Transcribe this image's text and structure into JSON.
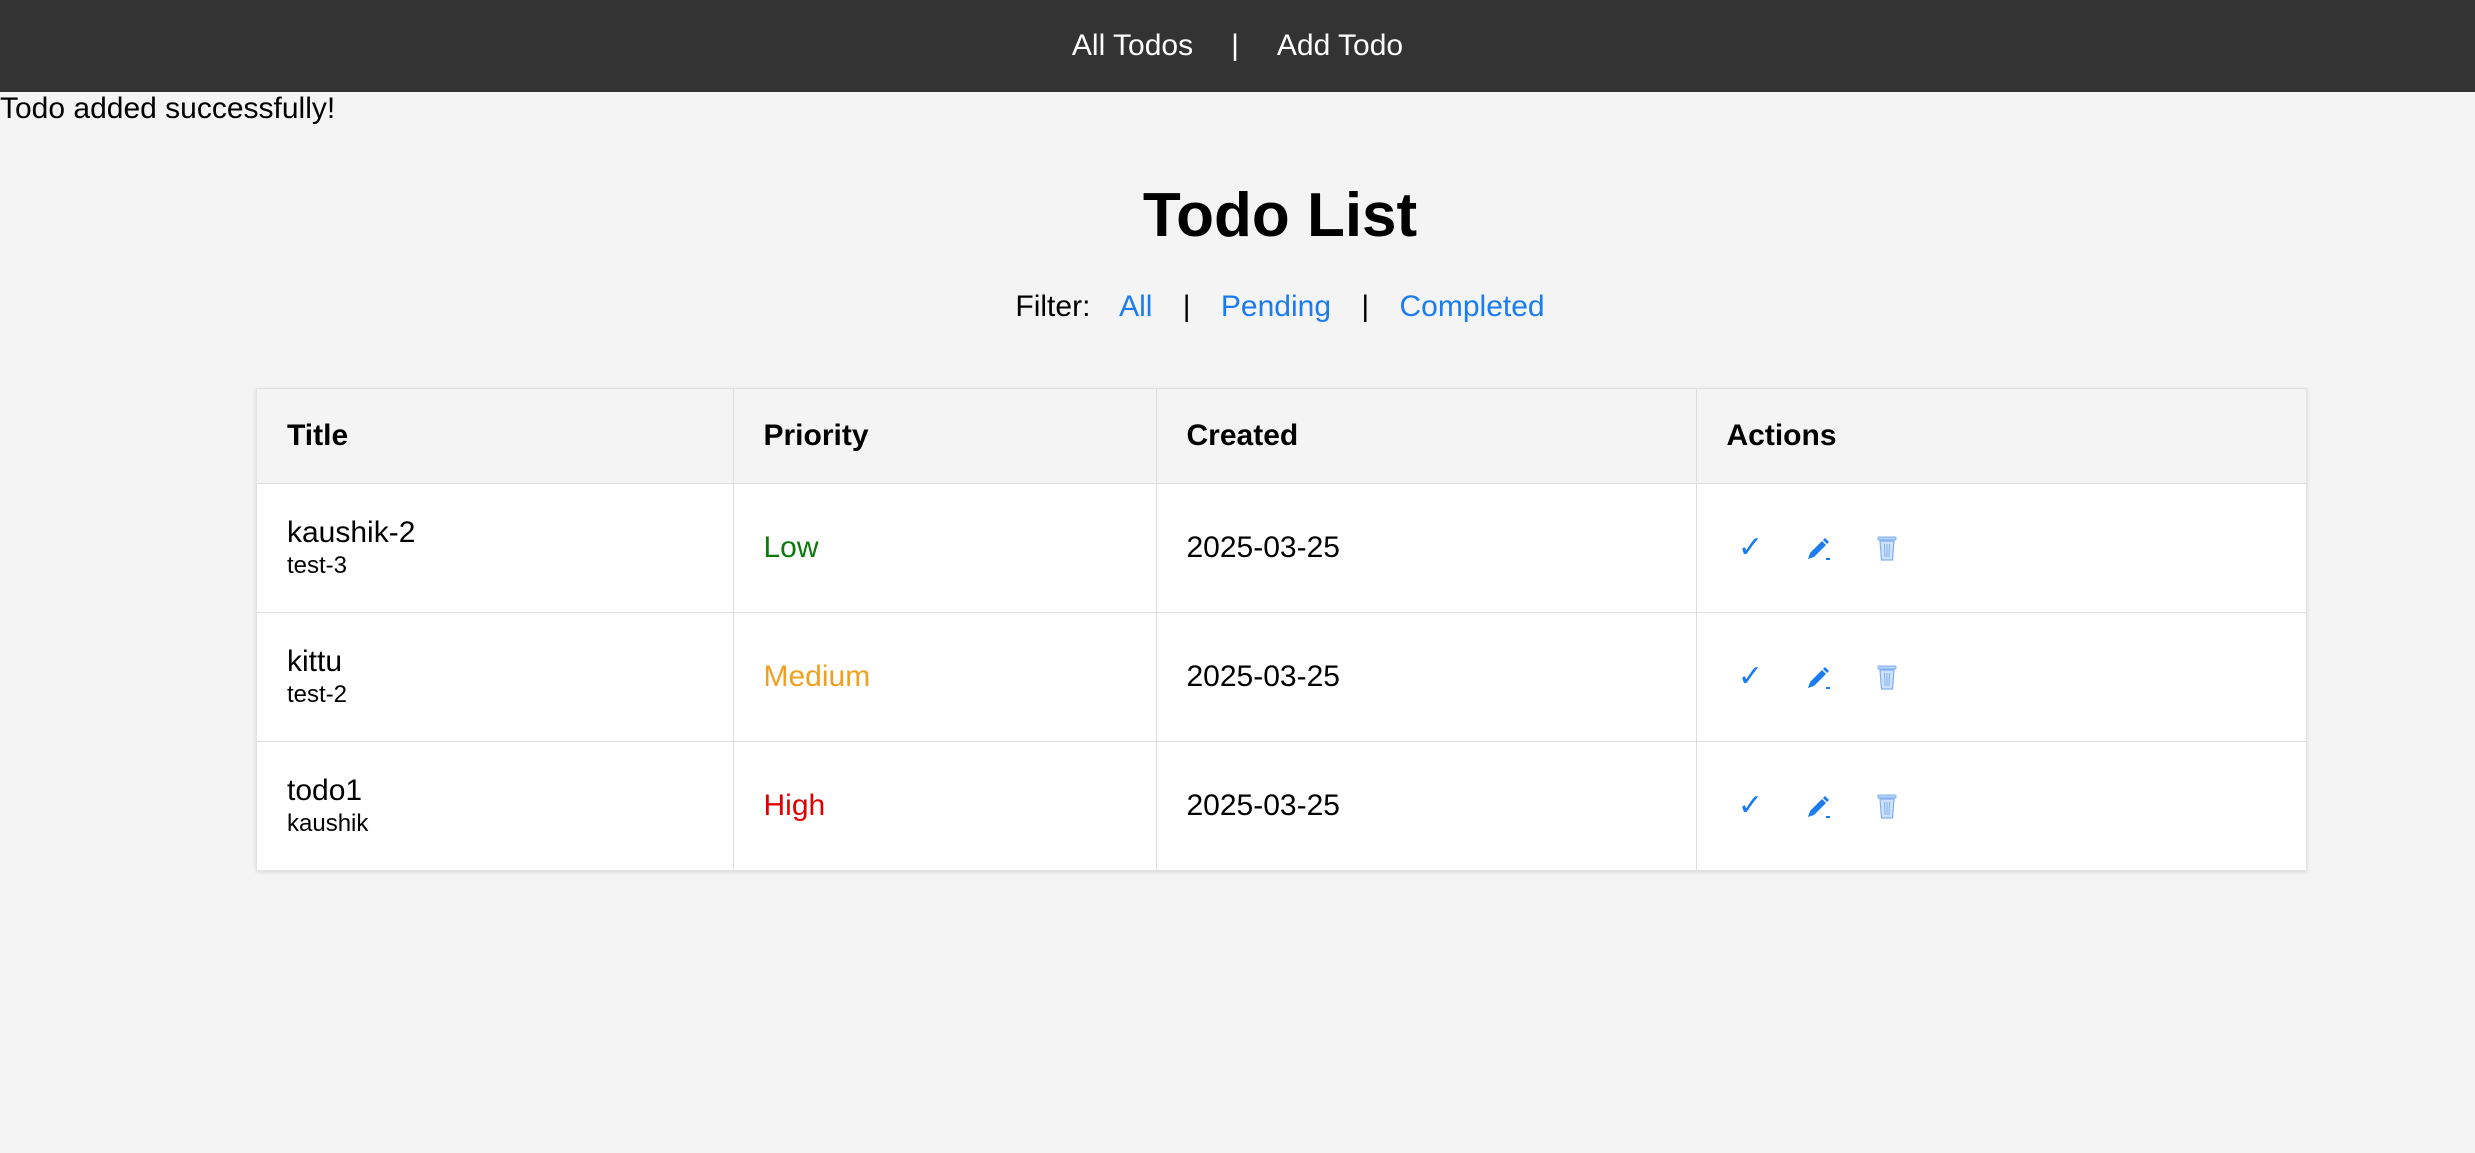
{
  "nav": {
    "all_todos": "All Todos",
    "separator": "|",
    "add_todo": "Add Todo"
  },
  "flash": "Todo added successfully!",
  "heading": "Todo List",
  "filter": {
    "label": "Filter:",
    "all": "All",
    "pending": "Pending",
    "completed": "Completed",
    "separator": "|"
  },
  "table": {
    "headers": [
      "Title",
      "Priority",
      "Created",
      "Actions"
    ],
    "rows": [
      {
        "title": "kaushik-2",
        "description": "test-3",
        "priority": "Low",
        "priority_color": "#0a7a0a",
        "created": "2025-03-25"
      },
      {
        "title": "kittu",
        "description": "test-2",
        "priority": "Medium",
        "priority_color": "#f0a020",
        "created": "2025-03-25"
      },
      {
        "title": "todo1",
        "description": "kaushik",
        "priority": "High",
        "priority_color": "#e00000",
        "created": "2025-03-25"
      }
    ],
    "action_icons": [
      "check-icon",
      "pencil-icon",
      "trash-icon"
    ]
  },
  "colors": {
    "nav_bg": "#333333",
    "link": "#1a7cf0",
    "page_bg": "#f4f4f4"
  }
}
